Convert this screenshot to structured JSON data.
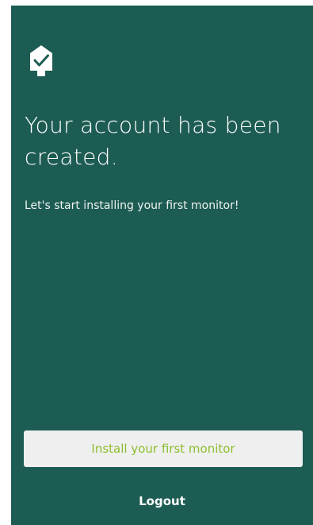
{
  "app": {
    "logo_icon": "house-check-icon"
  },
  "main": {
    "headline": "Your account has been created.",
    "subtext": "Let's start installing your first monitor!"
  },
  "actions": {
    "install_label": "Install your first monitor",
    "logout_label": "Logout"
  },
  "colors": {
    "background": "#1d5c52",
    "button_background": "#efefef",
    "button_text": "#8dbf2e",
    "text": "#ffffff"
  }
}
